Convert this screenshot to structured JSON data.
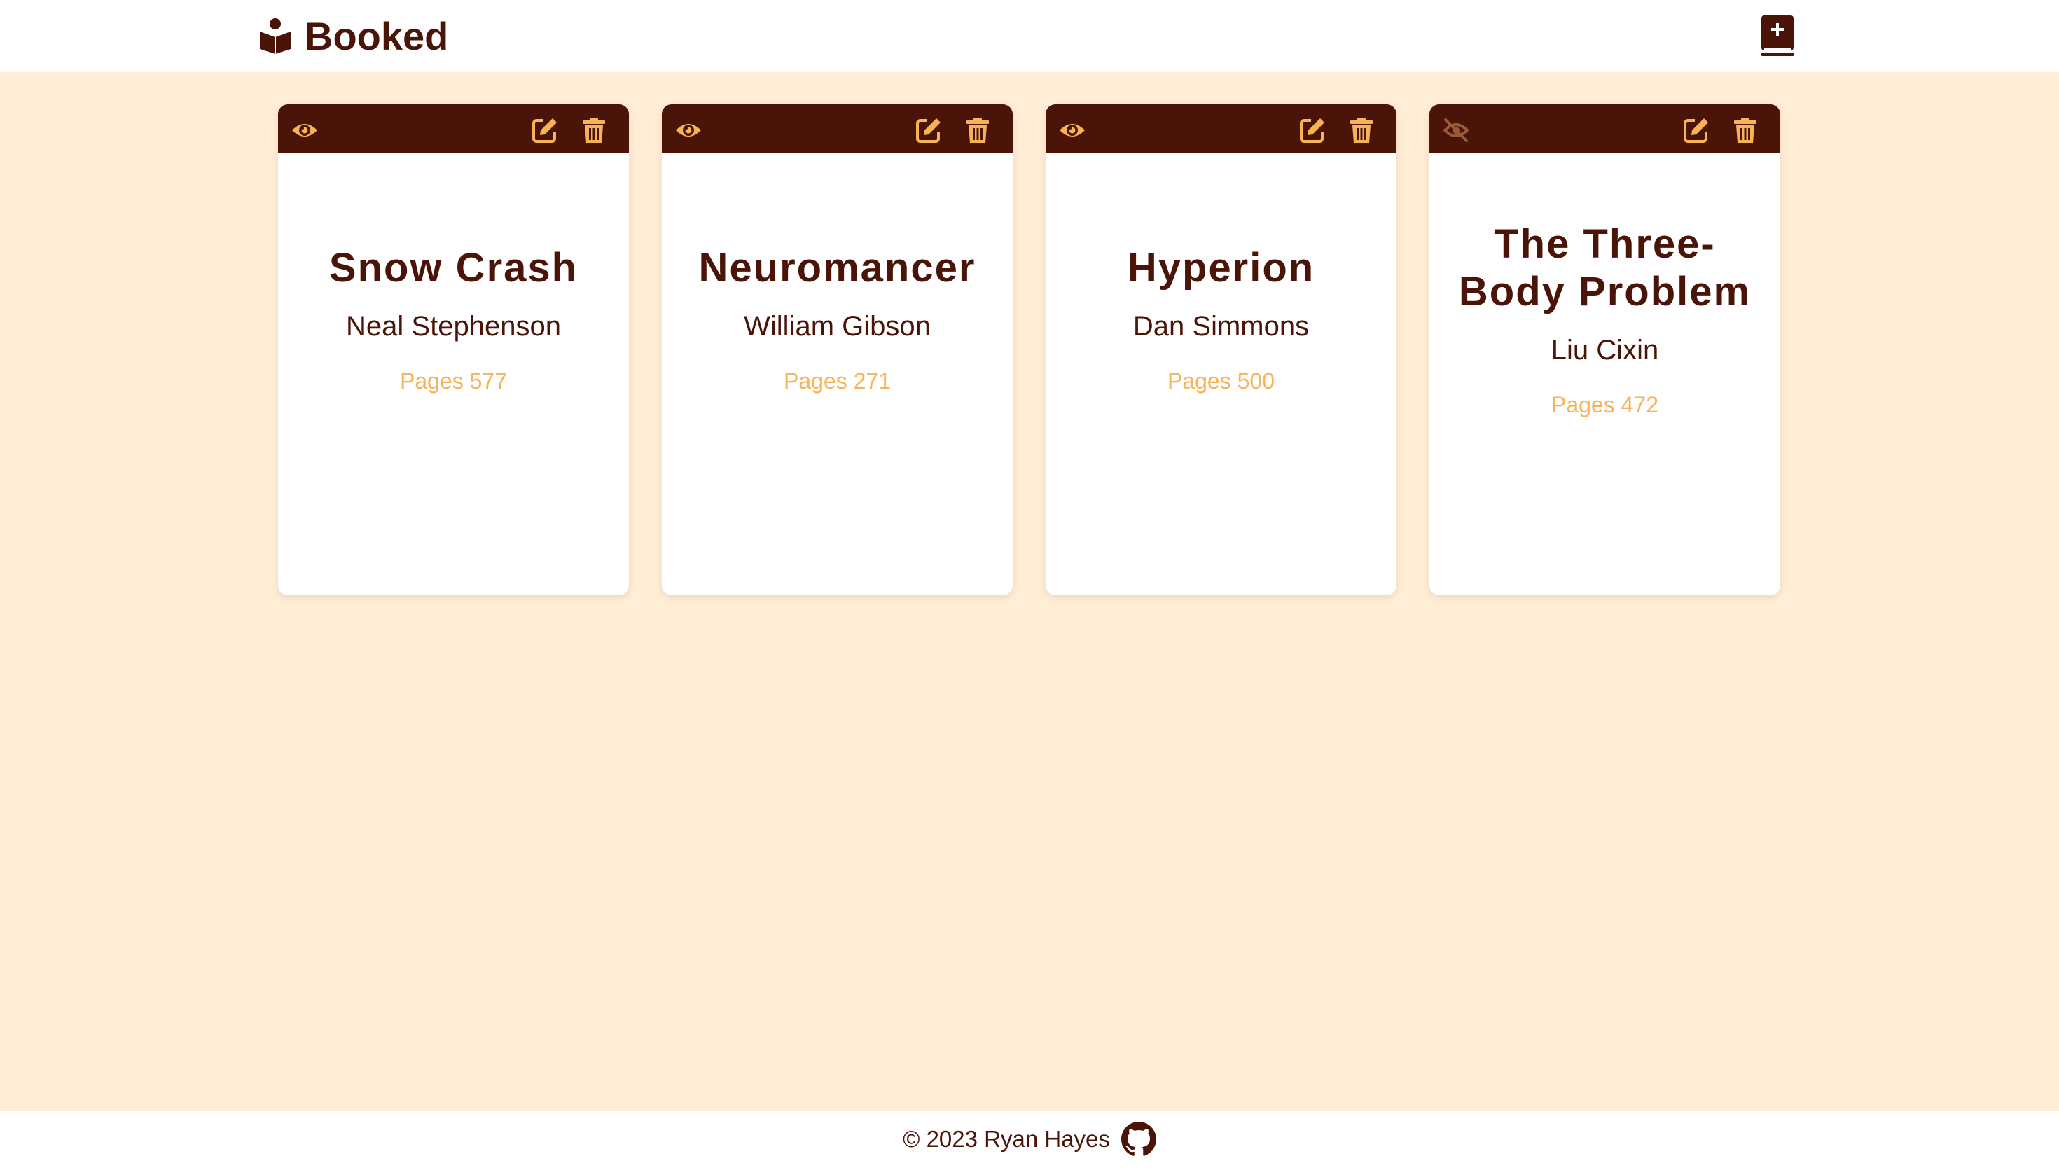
{
  "header": {
    "app_name": "Booked",
    "logo_icon": "book-reader-icon",
    "add_button_icon": "book-plus-icon"
  },
  "colors": {
    "background": "#FFEDD6",
    "primary": "#4A1508",
    "accent": "#F9B357",
    "surface": "#FFFFFF"
  },
  "books": [
    {
      "title": "Snow Crash",
      "author": "Neal Stephenson",
      "pages": "Pages 577",
      "read_icon": "eye-icon"
    },
    {
      "title": "Neuromancer",
      "author": "William Gibson",
      "pages": "Pages 271",
      "read_icon": "eye-icon"
    },
    {
      "title": "Hyperion",
      "author": "Dan Simmons",
      "pages": "Pages 500",
      "read_icon": "eye-icon"
    },
    {
      "title": "The Three-Body Problem",
      "author": "Liu Cixin",
      "pages": "Pages 472",
      "read_icon": "eye-slash-icon"
    }
  ],
  "card_actions": {
    "edit_icon": "edit-icon",
    "delete_icon": "trash-icon"
  },
  "footer": {
    "copyright": "© 2023 Ryan Hayes",
    "link_icon": "github-icon"
  }
}
